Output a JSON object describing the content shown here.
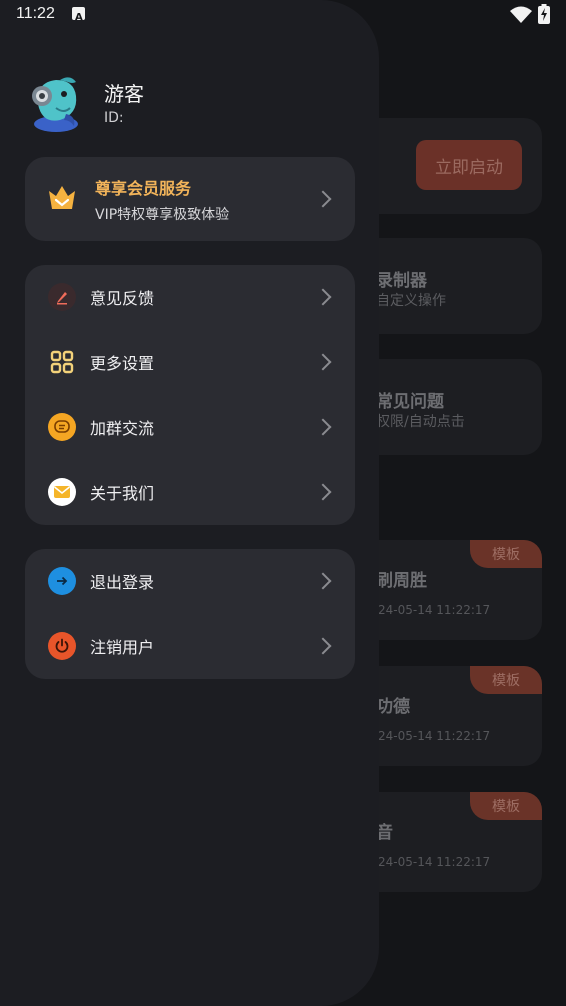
{
  "status_bar": {
    "time": "11:22",
    "notification_icon": "a-icon",
    "wifi_icon": "wifi-icon",
    "battery_icon": "battery-charging-icon"
  },
  "profile": {
    "name": "游客",
    "id_label": "ID:"
  },
  "vip": {
    "title": "尊享会员服务",
    "subtitle": "VIP特权尊享极致体验",
    "icon": "crown-icon"
  },
  "menu_primary": [
    {
      "label": "意见反馈",
      "icon": "feedback-pen-icon",
      "color": "#3a2a2d"
    },
    {
      "label": "更多设置",
      "icon": "settings-grid-icon",
      "color": "#2b2c32"
    },
    {
      "label": "加群交流",
      "icon": "chat-bubble-icon",
      "color": "#f5a623"
    },
    {
      "label": "关于我们",
      "icon": "mail-icon",
      "color": "#ffffff"
    }
  ],
  "menu_secondary": [
    {
      "label": "退出登录",
      "icon": "logout-arrow-icon",
      "color": "#1e8fe0"
    },
    {
      "label": "注销用户",
      "icon": "power-icon",
      "color": "#e8552a"
    }
  ],
  "background": {
    "start_button": "立即启动",
    "cards": [
      {
        "title": "录制器",
        "subtitle": "自定义操作"
      },
      {
        "title": "常见问题",
        "subtitle": "权限/自动点击"
      }
    ],
    "templates": [
      {
        "badge": "模板",
        "title": "刷周胜",
        "date": "24-05-14 11:22:17"
      },
      {
        "badge": "模板",
        "title": "功德",
        "date": "24-05-14 11:22:17"
      },
      {
        "badge": "模板",
        "title": "音",
        "date": "24-05-14 11:22:17"
      }
    ]
  },
  "colors": {
    "accent": "#f2b45a",
    "drawer_bg": "#1c1d22",
    "card_bg": "#2b2c32"
  }
}
